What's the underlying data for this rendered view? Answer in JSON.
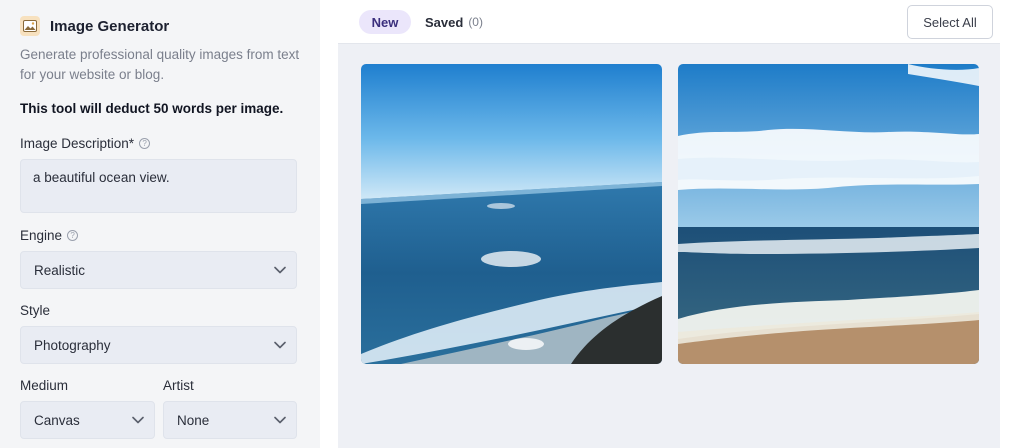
{
  "panel": {
    "title": "Image Generator",
    "icon": "image-icon",
    "description": "Generate professional quality images from text for your website or blog.",
    "deduct_note": "This tool will deduct 50 words per image."
  },
  "form": {
    "description_label": "Image Description*",
    "description_value": "a beautiful ocean view.",
    "engine_label": "Engine",
    "engine_value": "Realistic",
    "style_label": "Style",
    "style_value": "Photography",
    "medium_label": "Medium",
    "medium_value": "Canvas",
    "artist_label": "Artist",
    "artist_value": "None"
  },
  "tabs": {
    "new_label": "New",
    "saved_label": "Saved",
    "saved_count": "(0)"
  },
  "toolbar": {
    "select_all_label": "Select All"
  },
  "images": [
    {
      "name": "ocean-view-image-1",
      "subject": "ocean view from cliff"
    },
    {
      "name": "ocean-view-image-2",
      "subject": "ocean waves on beach"
    }
  ],
  "colors": {
    "accent_tab_bg": "#ebe6fb",
    "accent_tab_text": "#3b2f7d",
    "field_bg": "#e9ecf3",
    "panel_bg": "#f4f5f7"
  }
}
